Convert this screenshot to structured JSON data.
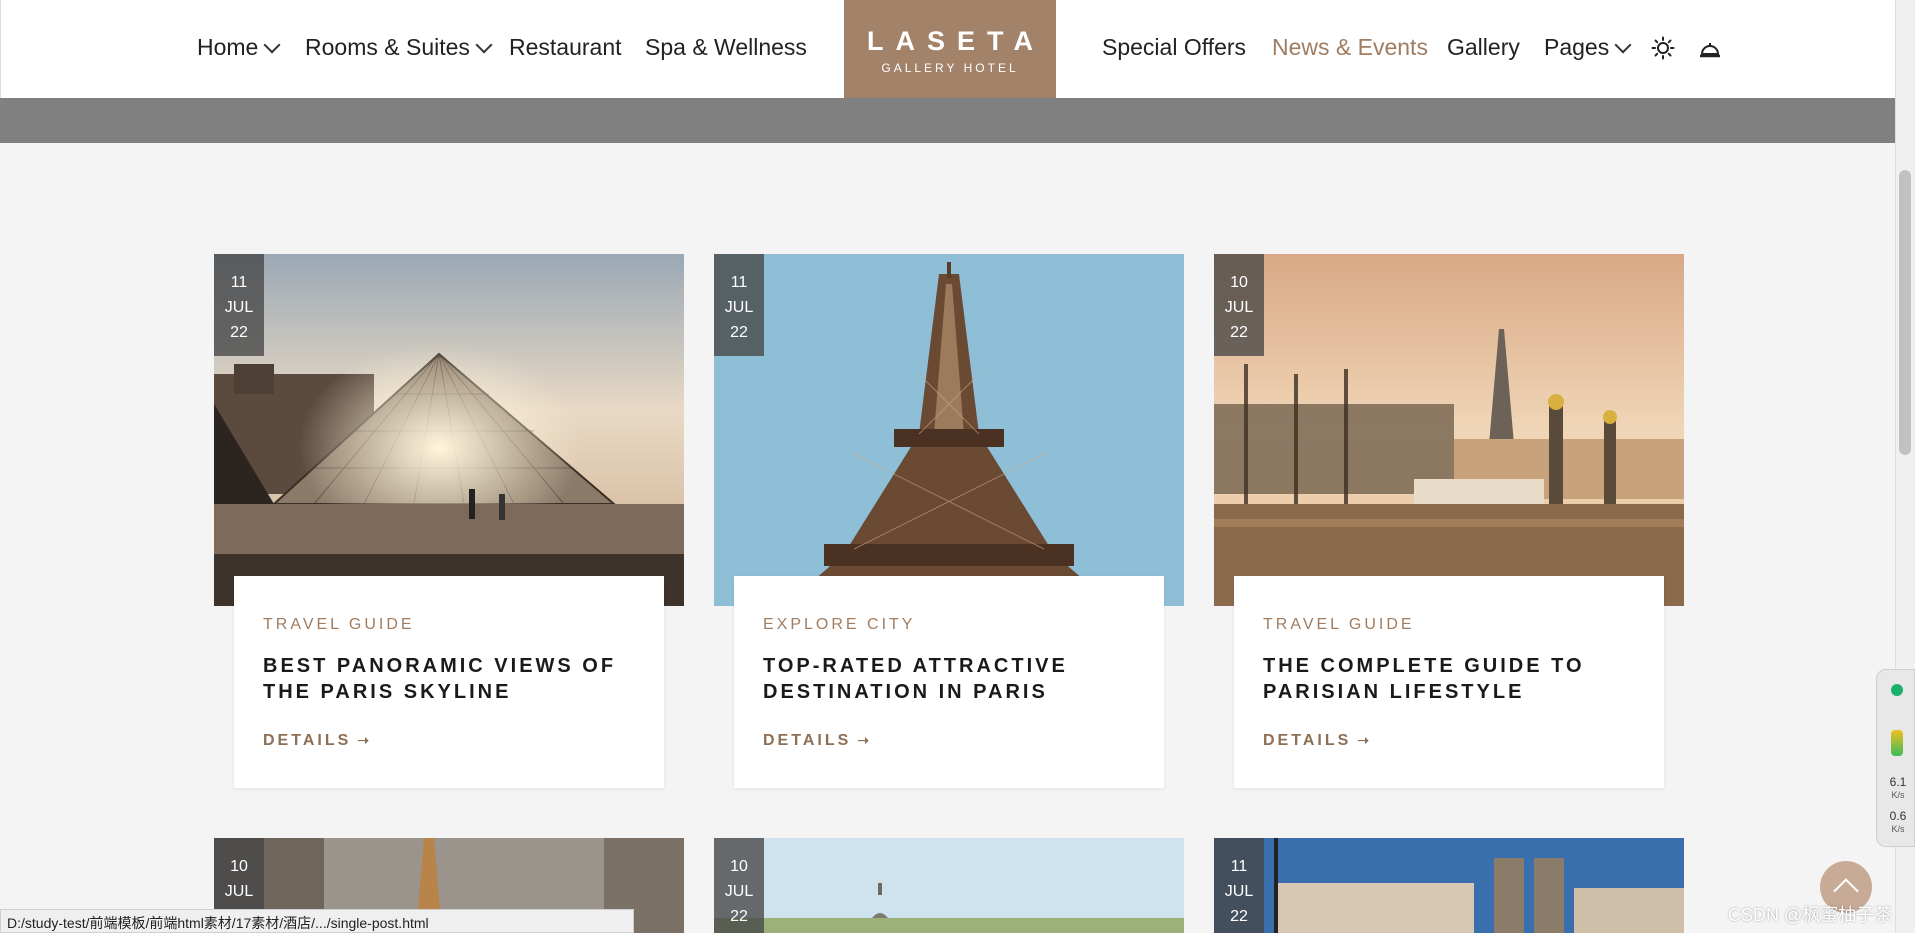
{
  "nav": {
    "left_items": [
      {
        "label": "Home",
        "has_dropdown": true
      },
      {
        "label": "Rooms & Suites",
        "has_dropdown": true
      },
      {
        "label": "Restaurant",
        "has_dropdown": false
      },
      {
        "label": "Spa & Wellness",
        "has_dropdown": false
      }
    ],
    "right_items": [
      {
        "label": "Special Offers",
        "has_dropdown": false,
        "active": false
      },
      {
        "label": "News & Events",
        "has_dropdown": false,
        "active": true
      },
      {
        "label": "Gallery",
        "has_dropdown": false,
        "active": false
      },
      {
        "label": "Pages",
        "has_dropdown": true,
        "active": false
      }
    ],
    "logo": {
      "name": "LASETA",
      "tagline": "GALLERY HOTEL"
    },
    "icons": [
      "sun-icon",
      "bell-icon"
    ]
  },
  "posts": [
    {
      "day": "11",
      "month": "JUL",
      "year": "22",
      "category": "TRAVEL GUIDE",
      "title": "BEST PANORAMIC VIEWS OF THE PARIS SKYLINE",
      "link": "DETAILS"
    },
    {
      "day": "11",
      "month": "JUL",
      "year": "22",
      "category": "EXPLORE CITY",
      "title": "TOP-RATED ATTRACTIVE DESTINATION IN PARIS",
      "link": "DETAILS"
    },
    {
      "day": "10",
      "month": "JUL",
      "year": "22",
      "category": "TRAVEL GUIDE",
      "title": "THE COMPLETE GUIDE TO PARISIAN LIFESTYLE",
      "link": "DETAILS"
    },
    {
      "day": "10",
      "month": "JUL",
      "year": ""
    },
    {
      "day": "10",
      "month": "JUL",
      "year": "22"
    },
    {
      "day": "11",
      "month": "JUL",
      "year": "22"
    }
  ],
  "status_bar": {
    "url": "D:/study-test/前端模板/前端html素材/17素材/酒店/.../single-post.html"
  },
  "network_widget": {
    "up_value": "6.1",
    "up_unit": "K/s",
    "down_value": "0.6",
    "down_unit": "K/s"
  },
  "watermark": "CSDN @枫蜜柚子茶",
  "colors": {
    "accent": "#a07d60",
    "logo_bg": "#a3826a",
    "badge_bg": "#464646"
  }
}
